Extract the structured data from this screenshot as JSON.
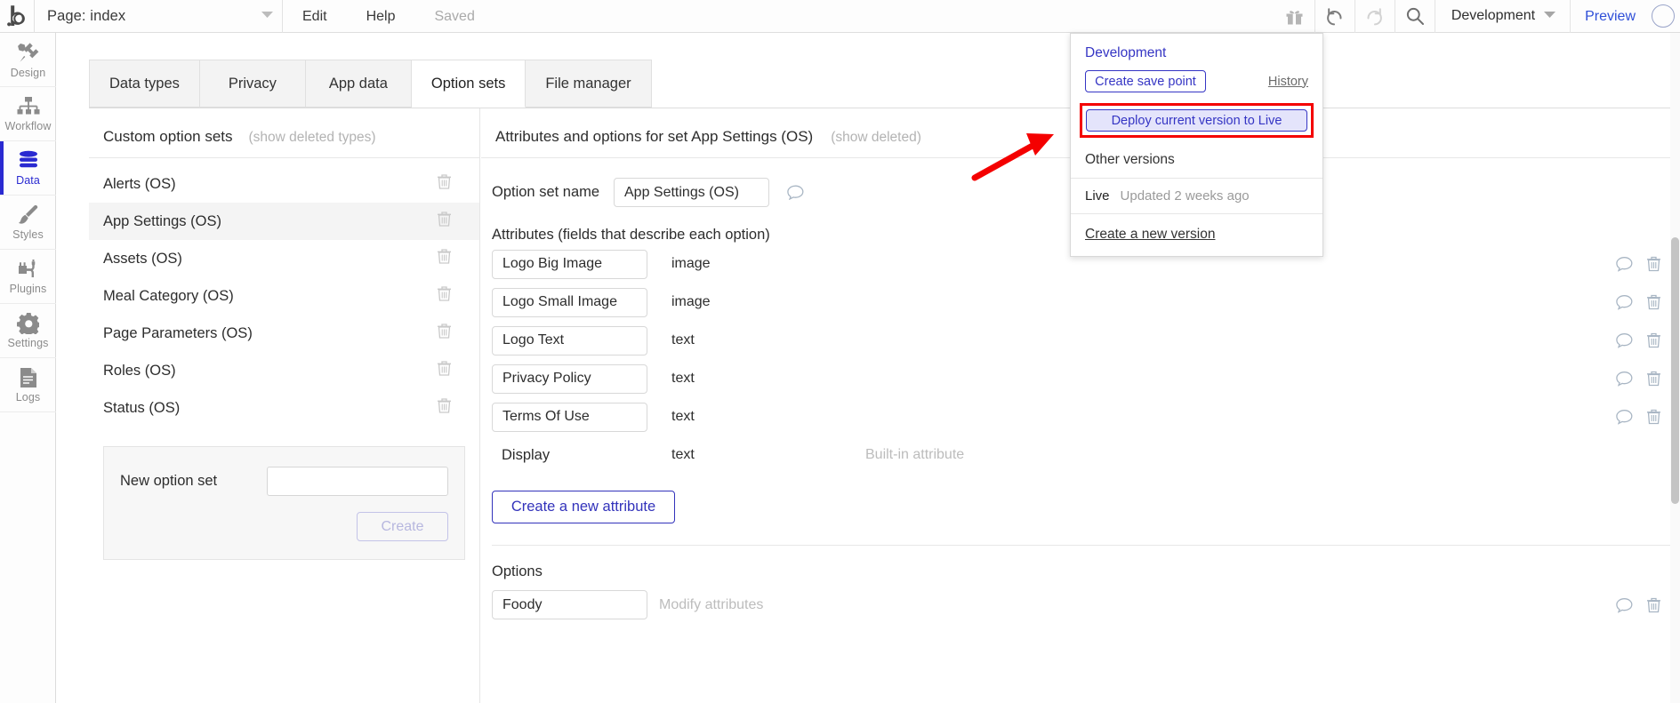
{
  "topbar": {
    "logo_icon": "bubble-logo-icon",
    "page_label": "Page: index",
    "page_caret_icon": "chevron-down-icon",
    "menu": [
      {
        "label": "Edit",
        "muted": false
      },
      {
        "label": "Help",
        "muted": false
      },
      {
        "label": "Saved",
        "muted": true
      }
    ],
    "icons": [
      {
        "name": "gift-icon"
      },
      {
        "name": "undo-icon"
      },
      {
        "name": "redo-icon"
      },
      {
        "name": "search-icon"
      }
    ],
    "environment": "Development",
    "environment_caret_icon": "chevron-down-icon",
    "preview": "Preview",
    "avatar_icon": "avatar-icon"
  },
  "rail": {
    "items": [
      {
        "label": "Design",
        "icon": "design-icon",
        "active": false
      },
      {
        "label": "Workflow",
        "icon": "workflow-icon",
        "active": false
      },
      {
        "label": "Data",
        "icon": "database-icon",
        "active": true
      },
      {
        "label": "Styles",
        "icon": "brush-icon",
        "active": false
      },
      {
        "label": "Plugins",
        "icon": "plug-icon",
        "active": false
      },
      {
        "label": "Settings",
        "icon": "gear-icon",
        "active": false
      },
      {
        "label": "Logs",
        "icon": "document-icon",
        "active": false
      }
    ]
  },
  "tabs": [
    {
      "label": "Data types",
      "active": false
    },
    {
      "label": "Privacy",
      "active": false
    },
    {
      "label": "App data",
      "active": false
    },
    {
      "label": "Option sets",
      "active": true
    },
    {
      "label": "File manager",
      "active": false
    }
  ],
  "left_panel": {
    "title": "Custom option sets",
    "show_deleted_link": "(show deleted types)",
    "option_sets": [
      {
        "name": "Alerts (OS)",
        "selected": false
      },
      {
        "name": "App Settings (OS)",
        "selected": true
      },
      {
        "name": "Assets (OS)",
        "selected": false
      },
      {
        "name": "Meal Category (OS)",
        "selected": false
      },
      {
        "name": "Page Parameters (OS)",
        "selected": false
      },
      {
        "name": "Roles (OS)",
        "selected": false
      },
      {
        "name": "Status (OS)",
        "selected": false
      }
    ],
    "new_set": {
      "label": "New option set",
      "value": "",
      "create_label": "Create"
    }
  },
  "right_panel": {
    "title": "Attributes and options for set App Settings (OS)",
    "show_deleted_link": "(show deleted)",
    "name_label": "Option set name",
    "name_value": "App Settings (OS)",
    "attributes_title": "Attributes (fields that describe each option)",
    "attributes": [
      {
        "name": "Logo Big Image",
        "type": "image",
        "builtin": "",
        "editable": true
      },
      {
        "name": "Logo Small Image",
        "type": "image",
        "builtin": "",
        "editable": true
      },
      {
        "name": "Logo Text",
        "type": "text",
        "builtin": "",
        "editable": true
      },
      {
        "name": "Privacy Policy",
        "type": "text",
        "builtin": "",
        "editable": true
      },
      {
        "name": "Terms Of Use",
        "type": "text",
        "builtin": "",
        "editable": true
      },
      {
        "name": "Display",
        "type": "text",
        "builtin": "Built-in attribute",
        "editable": false
      }
    ],
    "create_attribute_label": "Create a new attribute",
    "options_title": "Options",
    "options": [
      {
        "name": "Foody",
        "modify_label": "Modify attributes"
      }
    ]
  },
  "version_dropdown": {
    "title": "Development",
    "create_save_point": "Create save point",
    "history": "History",
    "deploy": "Deploy current version to Live",
    "other_versions": "Other versions",
    "live_name": "Live",
    "live_updated": "Updated 2 weeks ago",
    "create_new_version": "Create a new version"
  },
  "annotation": {
    "highlight_color": "#f40000",
    "arrow_color": "#f40000"
  }
}
